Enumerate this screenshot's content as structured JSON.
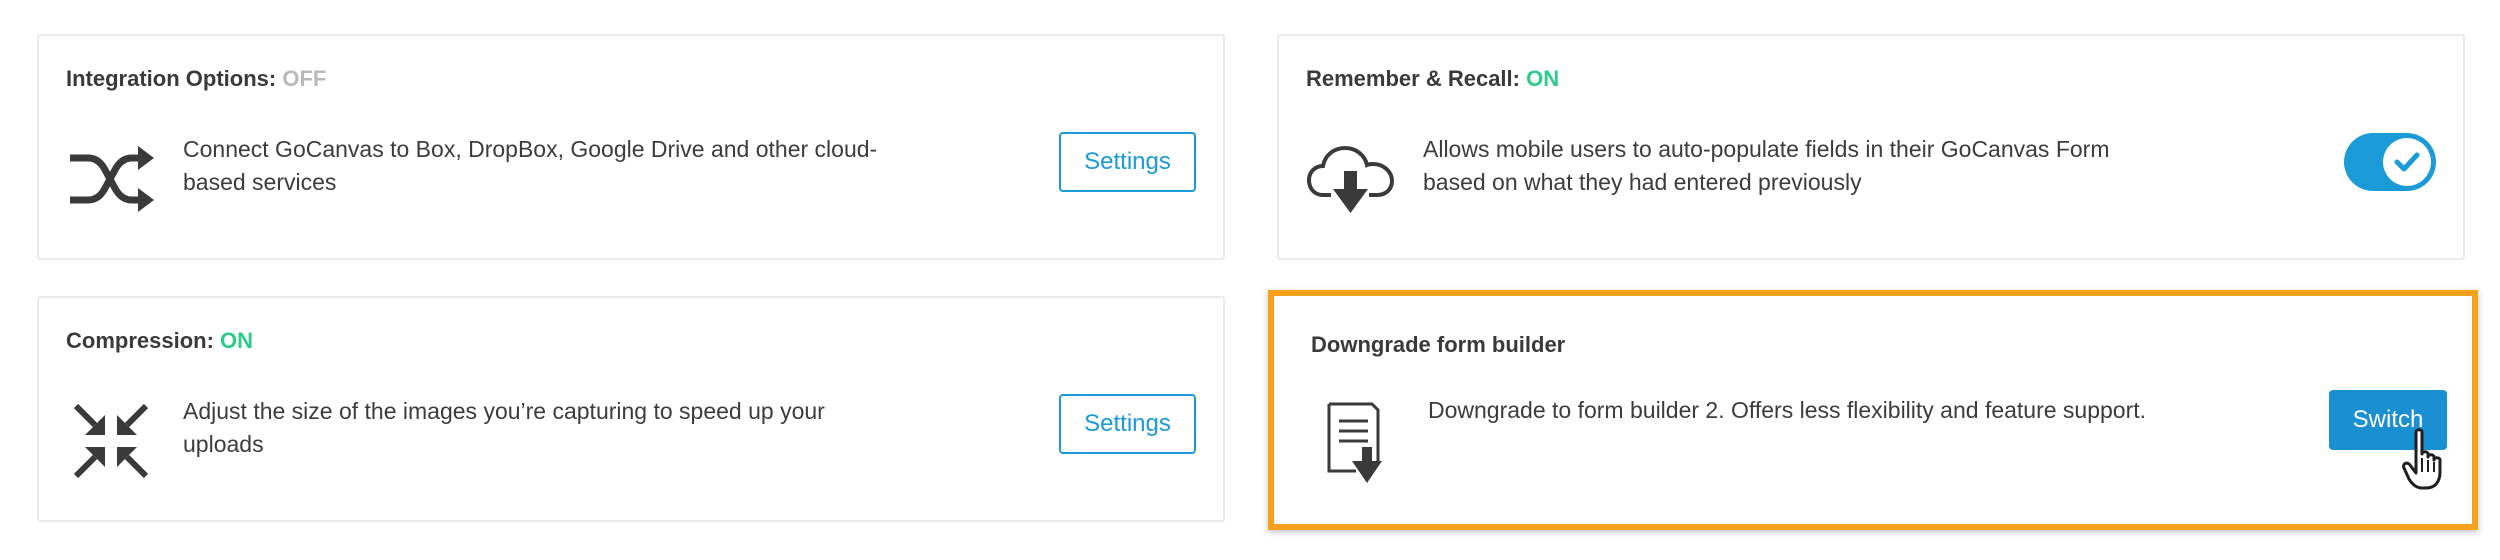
{
  "integration": {
    "title": "Integration Options:",
    "status": "OFF",
    "description": "Connect GoCanvas to Box, DropBox, Google Drive and other cloud-based services",
    "button_label": "Settings",
    "icon": "shuffle-icon"
  },
  "remember": {
    "title": "Remember & Recall:",
    "status": "ON",
    "description": "Allows mobile users to auto-populate fields in their GoCanvas Form based on what they had entered previously",
    "toggle_on": true,
    "icon": "cloud-download-icon"
  },
  "compression": {
    "title": "Compression:",
    "status": "ON",
    "description": "Adjust the size of the images you’re capturing to speed up your uploads",
    "button_label": "Settings",
    "icon": "compress-icon"
  },
  "downgrade": {
    "title": "Downgrade form builder",
    "description": "Downgrade to form builder 2. Offers less flexibility and feature support.",
    "button_label": "Switch",
    "icon": "document-download-icon"
  },
  "colors": {
    "accent": "#1a9ad6",
    "status_on": "#2ecc8a",
    "status_off": "#b9b9b9",
    "highlight": "#f5a11e"
  }
}
